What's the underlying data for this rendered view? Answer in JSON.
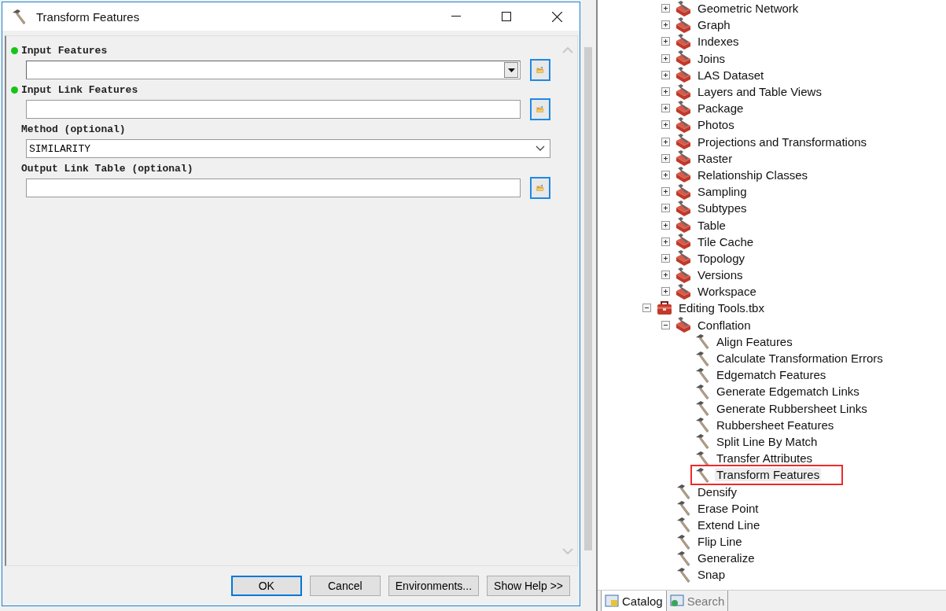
{
  "dialog": {
    "title": "Transform Features",
    "parameters": [
      {
        "label": "Input Features",
        "required": true,
        "kind": "combo"
      },
      {
        "label": "Input Link Features",
        "required": true,
        "kind": "text"
      },
      {
        "label": "Method (optional)",
        "required": false,
        "kind": "select",
        "value": "SIMILARITY"
      },
      {
        "label": "Output Link Table (optional)",
        "required": false,
        "kind": "text"
      }
    ],
    "buttons": [
      {
        "label": "OK",
        "default": true
      },
      {
        "label": "Cancel",
        "default": false
      },
      {
        "label": "Environments...",
        "default": false
      },
      {
        "label": "Show Help >>",
        "default": false
      }
    ]
  },
  "catalog_tree": {
    "continued_items": [
      {
        "label": "Geometric Network",
        "kind": "toolset",
        "expanded": false
      },
      {
        "label": "Graph",
        "kind": "toolset",
        "expanded": false
      },
      {
        "label": "Indexes",
        "kind": "toolset",
        "expanded": false
      },
      {
        "label": "Joins",
        "kind": "toolset",
        "expanded": false
      },
      {
        "label": "LAS Dataset",
        "kind": "toolset",
        "expanded": false
      },
      {
        "label": "Layers and Table Views",
        "kind": "toolset",
        "expanded": false
      },
      {
        "label": "Package",
        "kind": "toolset",
        "expanded": false
      },
      {
        "label": "Photos",
        "kind": "toolset",
        "expanded": false
      },
      {
        "label": "Projections and Transformations",
        "kind": "toolset",
        "expanded": false
      },
      {
        "label": "Raster",
        "kind": "toolset",
        "expanded": false
      },
      {
        "label": "Relationship Classes",
        "kind": "toolset",
        "expanded": false
      },
      {
        "label": "Sampling",
        "kind": "toolset",
        "expanded": false
      },
      {
        "label": "Subtypes",
        "kind": "toolset",
        "expanded": false
      },
      {
        "label": "Table",
        "kind": "toolset",
        "expanded": false
      },
      {
        "label": "Tile Cache",
        "kind": "toolset",
        "expanded": false
      },
      {
        "label": "Topology",
        "kind": "toolset",
        "expanded": false
      },
      {
        "label": "Versions",
        "kind": "toolset",
        "expanded": false
      },
      {
        "label": "Workspace",
        "kind": "toolset",
        "expanded": false
      }
    ],
    "items": [
      {
        "label": "Editing Tools.tbx",
        "kind": "toolbox",
        "expanded": true,
        "children": [
          {
            "label": "Conflation",
            "kind": "toolset",
            "expanded": true,
            "children": [
              {
                "label": "Align Features",
                "kind": "tool",
                "selected": false,
                "marked": false
              },
              {
                "label": "Calculate Transformation Errors",
                "kind": "tool",
                "selected": false,
                "marked": false
              },
              {
                "label": "Edgematch Features",
                "kind": "tool",
                "selected": false,
                "marked": false
              },
              {
                "label": "Generate Edgematch Links",
                "kind": "tool",
                "selected": false,
                "marked": false
              },
              {
                "label": "Generate Rubbersheet Links",
                "kind": "tool",
                "selected": false,
                "marked": false
              },
              {
                "label": "Rubbersheet Features",
                "kind": "tool",
                "selected": false,
                "marked": false
              },
              {
                "label": "Split Line By Match",
                "kind": "tool",
                "selected": false,
                "marked": false
              },
              {
                "label": "Transfer Attributes",
                "kind": "tool",
                "selected": false,
                "marked": false
              },
              {
                "label": "Transform Features",
                "kind": "tool",
                "selected": true,
                "marked": true
              }
            ]
          },
          {
            "label": "Densify",
            "kind": "tool",
            "selected": false,
            "marked": false
          },
          {
            "label": "Erase Point",
            "kind": "tool",
            "selected": false,
            "marked": false
          },
          {
            "label": "Extend Line",
            "kind": "tool",
            "selected": false,
            "marked": false
          },
          {
            "label": "Flip Line",
            "kind": "tool",
            "selected": false,
            "marked": false
          },
          {
            "label": "Generalize",
            "kind": "tool",
            "selected": false,
            "marked": false
          },
          {
            "label": "Snap",
            "kind": "tool",
            "selected": false,
            "marked": false
          }
        ]
      }
    ]
  },
  "bottom_tabs": [
    {
      "label": "Catalog",
      "selected": true
    },
    {
      "label": "Search",
      "selected": false
    }
  ]
}
